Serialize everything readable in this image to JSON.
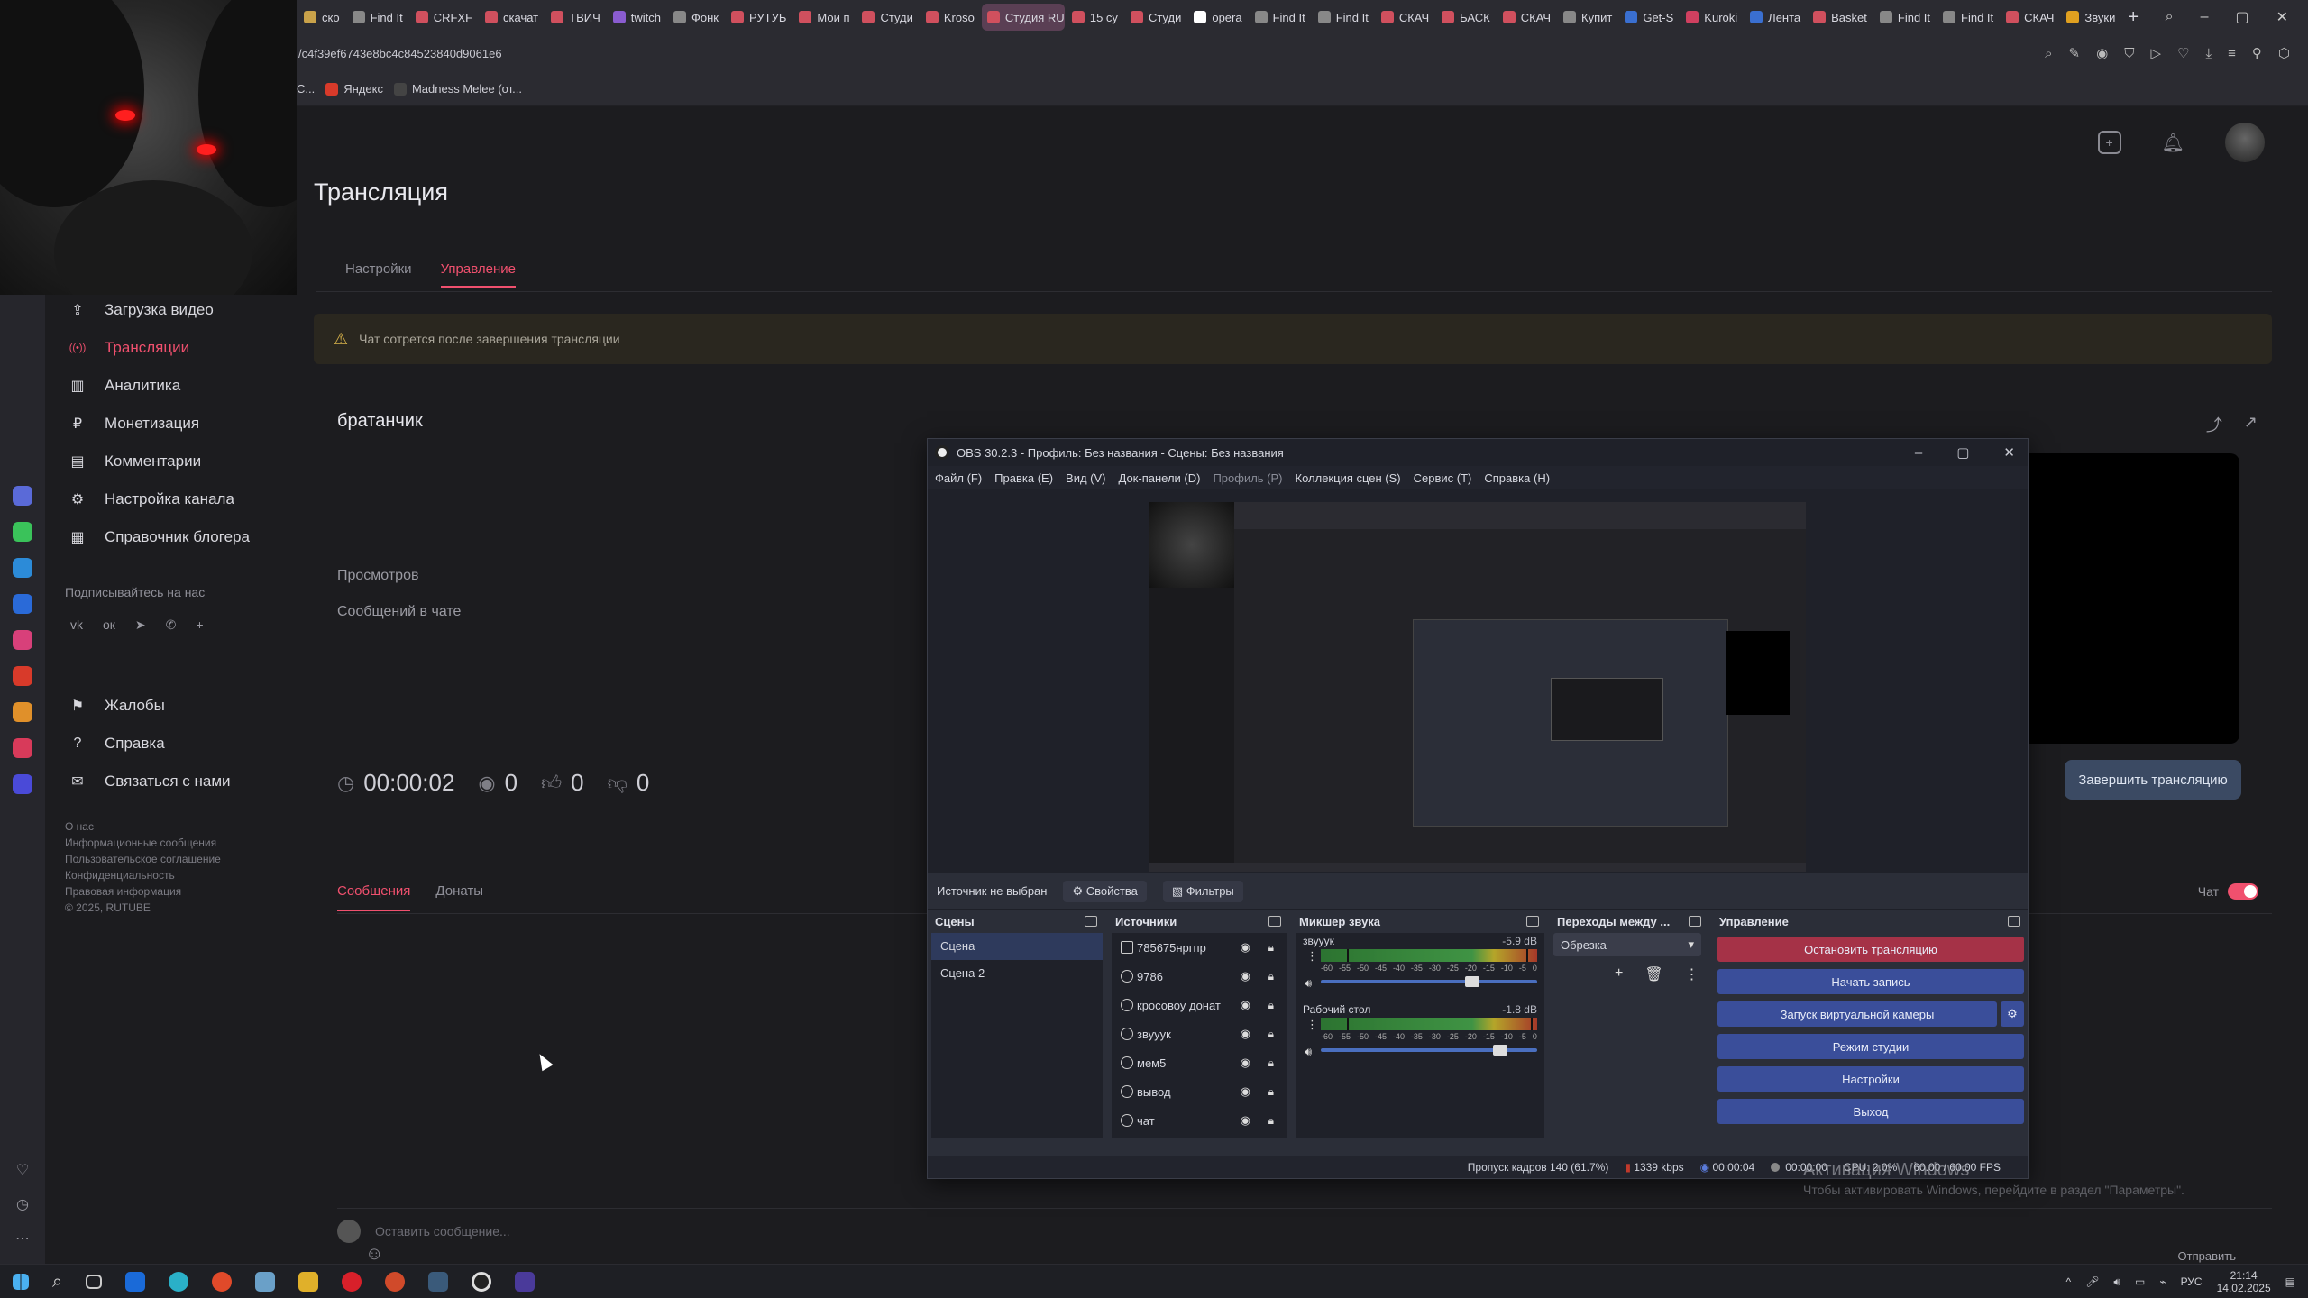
{
  "browser": {
    "tabs": [
      {
        "label": "ско",
        "color": "#c9a24a"
      },
      {
        "label": "Find It",
        "color": "#888888"
      },
      {
        "label": "CRFXF",
        "color": "#d0505e"
      },
      {
        "label": "скачат",
        "color": "#d0505e"
      },
      {
        "label": "ТВИЧ",
        "color": "#d0505e"
      },
      {
        "label": "twitch",
        "color": "#8a5cd0"
      },
      {
        "label": "Фонк",
        "color": "#888888"
      },
      {
        "label": "РУТУБ",
        "color": "#d0505e"
      },
      {
        "label": "Мои п",
        "color": "#d0505e"
      },
      {
        "label": "Студи",
        "color": "#d0505e"
      },
      {
        "label": "Krosо",
        "color": "#d0505e"
      },
      {
        "label": "Студия RUT",
        "color": "#d0505e",
        "active": true
      },
      {
        "label": "15 су",
        "color": "#d0505e"
      },
      {
        "label": "Студи",
        "color": "#d0505e"
      },
      {
        "label": "opera",
        "color": "#ffffff"
      },
      {
        "label": "Find It",
        "color": "#888888"
      },
      {
        "label": "Find It",
        "color": "#888888"
      },
      {
        "label": "СКАЧ",
        "color": "#d0505e"
      },
      {
        "label": "БАСК",
        "color": "#d0505e"
      },
      {
        "label": "СКАЧ",
        "color": "#d0505e"
      },
      {
        "label": "Купит",
        "color": "#888888"
      },
      {
        "label": "Get-S",
        "color": "#3a6fd0"
      },
      {
        "label": "Kuroki",
        "color": "#d04060"
      },
      {
        "label": "Лента",
        "color": "#3a6fd0"
      },
      {
        "label": "Basket",
        "color": "#d0505e"
      },
      {
        "label": "Find It",
        "color": "#888888"
      },
      {
        "label": "Find It",
        "color": "#888888"
      },
      {
        "label": "СКАЧ",
        "color": "#d0505e"
      },
      {
        "label": "Звуки",
        "color": "#e0a020"
      }
    ],
    "url": "/c4f39ef6743e8bc4c84523840d9061e6",
    "bookmarks": [
      "C...",
      "Яндекс",
      "Madness Melee (от..."
    ]
  },
  "page": {
    "title": "Трансляция",
    "tabs": [
      "Настройки",
      "Управление"
    ],
    "notice": "Чат сотрется после завершения трансляции",
    "stream_title": "братанчик",
    "views_label": "Просмотров",
    "messages_label": "Сообщений в чате",
    "timer": "00:00:02",
    "viewers": "0",
    "likes": "0",
    "dislikes": "0",
    "end_button": "Завершить трансляцию",
    "chat_tabs": [
      "Сообщения",
      "Донаты"
    ],
    "chat_toggle_label": "Чат",
    "message_placeholder": "Оставить сообщение...",
    "send_label": "Отправить"
  },
  "sidebar": {
    "items": [
      {
        "label": "Загрузка видео",
        "icon": "upload-icon"
      },
      {
        "label": "Трансляции",
        "icon": "broadcast-icon",
        "active": true
      },
      {
        "label": "Аналитика",
        "icon": "chart-icon"
      },
      {
        "label": "Монетизация",
        "icon": "coin-icon"
      },
      {
        "label": "Комментарии",
        "icon": "comment-icon"
      },
      {
        "label": "Настройка канала",
        "icon": "gear-icon"
      },
      {
        "label": "Справочник блогера",
        "icon": "book-icon"
      }
    ],
    "follow_label": "Подписывайтесь на нас",
    "bottom_items": [
      {
        "label": "Жалобы",
        "icon": "flag-icon"
      },
      {
        "label": "Справка",
        "icon": "help-icon"
      },
      {
        "label": "Связаться с нами",
        "icon": "mail-icon"
      }
    ],
    "footer": [
      "О нас",
      "Информационные сообщения",
      "Пользовательское соглашение",
      "Конфиденциальность",
      "Правовая информация",
      "© 2025, RUTUBE"
    ]
  },
  "obs": {
    "title": "OBS 30.2.3 - Профиль: Без названия - Сцены: Без названия",
    "menu": [
      "Файл (F)",
      "Правка (E)",
      "Вид (V)",
      "Док-панели (D)",
      "Профиль (P)",
      "Коллекция сцен (S)",
      "Сервис (T)",
      "Справка (H)"
    ],
    "no_source": "Источник не выбран",
    "properties": "Свойства",
    "filters": "Фильтры",
    "docks": {
      "scenes": "Сцены",
      "sources": "Источники",
      "mixer": "Микшер звука",
      "transitions": "Переходы между ...",
      "controls": "Управление"
    },
    "scenes": [
      "Сцена",
      "Сцена 2"
    ],
    "sources": [
      "785675нргпр",
      "9786",
      "кросовоу донат",
      "звууук",
      "мем5",
      "вывод",
      "чат"
    ],
    "mixer": [
      {
        "name": "звууук",
        "db": "-5.9 dB",
        "level": 0.95,
        "volume": 0.7
      },
      {
        "name": "Рабочий стол",
        "db": "-1.8 dB",
        "level": 0.97,
        "volume": 0.83
      }
    ],
    "scale": [
      "-60",
      "-55",
      "-50",
      "-45",
      "-40",
      "-35",
      "-30",
      "-25",
      "-20",
      "-15",
      "-10",
      "-5",
      "0"
    ],
    "transition": "Обрезка",
    "controls": {
      "stop_stream": "Остановить трансляцию",
      "start_record": "Начать запись",
      "virtual_cam": "Запуск виртуальной камеры",
      "studio_mode": "Режим студии",
      "settings": "Настройки",
      "exit": "Выход"
    },
    "status": {
      "dropped": "Пропуск кадров 140 (61.7%)",
      "bitrate": "1339 kbps",
      "time": "00:00:04",
      "rec_time": "00:00:00",
      "cpu": "CPU: 2.0%",
      "fps": "60.00 / 60.00 FPS"
    }
  },
  "windows": {
    "watermark": "Активация Windows",
    "watermark_sub": "Чтобы активировать Windows, перейдите в раздел \"Параметры\".",
    "lang": "РУС",
    "time": "21:14",
    "date": "14.02.2025"
  }
}
